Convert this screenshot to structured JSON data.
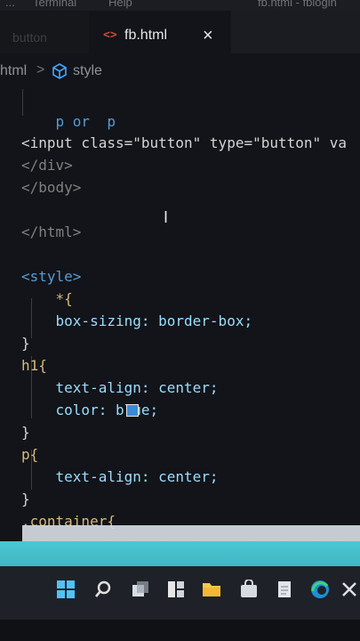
{
  "menubar": {
    "items": [
      "...",
      "Terminal",
      "Help"
    ],
    "title": "fb.html - fblogin"
  },
  "tabs": [
    {
      "label": "button",
      "active": false
    },
    {
      "label": "fb.html",
      "active": true,
      "close": "×"
    }
  ],
  "breadcrumb": {
    "items": [
      "html",
      "style"
    ],
    "separator": ">"
  },
  "code_lines": [
    {
      "text": "    p or  p"
    },
    {
      "text": "<input class=\"button\" type=\"button\" va"
    },
    {
      "text": "</div>"
    },
    {
      "text": "</body>"
    },
    {
      "text": ""
    },
    {
      "text": "</html>"
    },
    {
      "text": ""
    },
    {
      "text": "<style>"
    },
    {
      "text": "    *{"
    },
    {
      "text": "    box-sizing: border-box;"
    },
    {
      "text": "}"
    },
    {
      "text": "h1{"
    },
    {
      "text": "    text-align: center;"
    },
    {
      "text": "    color: blue;"
    },
    {
      "text": "}"
    },
    {
      "text": "p{"
    },
    {
      "text": "    text-align: center;"
    },
    {
      "text": "}"
    },
    {
      "text": ".container{"
    }
  ],
  "colors": {
    "swatch_blue": "#3b8ad8",
    "accent_taskbar": "#4cc7d4"
  },
  "taskbar": {
    "icons": [
      "windows-start-icon",
      "search-icon",
      "task-view-icon",
      "widgets-icon",
      "file-explorer-icon",
      "store-icon",
      "notepad-icon",
      "edge-icon",
      "close-icon"
    ]
  }
}
